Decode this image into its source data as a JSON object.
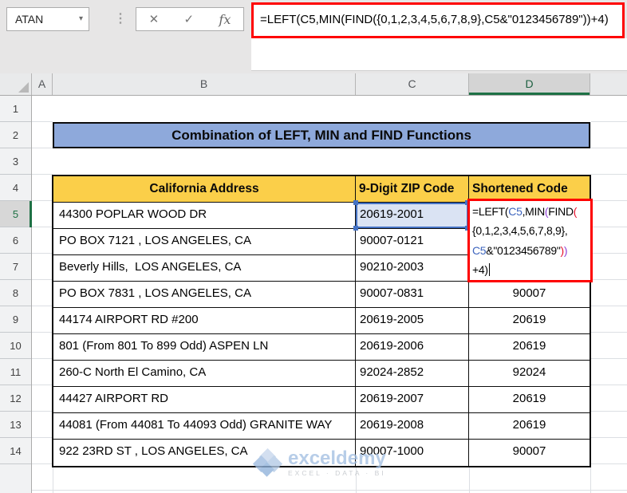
{
  "chrome": {
    "name_box": "ATAN",
    "formula": "=LEFT(C5,MIN(FIND({0,1,2,3,4,5,6,7,8,9},C5&\"0123456789\"))+4)",
    "cancel_icon": "✕",
    "enter_icon": "✓",
    "fx_icon": "fx",
    "dropdown_icon": "▼",
    "dots_icon": "⋮"
  },
  "grid": {
    "columns": [
      "A",
      "B",
      "C",
      "D"
    ],
    "selected_column": "D",
    "rows": [
      1,
      2,
      3,
      4,
      5,
      6,
      7,
      8,
      9,
      10,
      11,
      12,
      13,
      14
    ],
    "selected_row": 5
  },
  "sheet": {
    "title": "Combination of LEFT, MIN and FIND Functions",
    "table": {
      "headers": [
        "California Address",
        "9-Digit ZIP Code",
        "Shortened Code"
      ],
      "rows": [
        {
          "address": "44300 POPLAR WOOD DR",
          "zip": "20619-2001",
          "code": ""
        },
        {
          "address": "PO BOX 7121 , LOS ANGELES, CA",
          "zip": "90007-0121",
          "code": ""
        },
        {
          "address": "Beverly Hills,  LOS ANGELES, CA",
          "zip": "90210-2003",
          "code": ""
        },
        {
          "address": "PO BOX 7831 , LOS ANGELES, CA",
          "zip": "90007-0831",
          "code": "90007"
        },
        {
          "address": "44174 AIRPORT RD #200",
          "zip": "20619-2005",
          "code": "20619"
        },
        {
          "address": "801 (From 801 To 899 Odd) ASPEN LN",
          "zip": "20619-2006",
          "code": "20619"
        },
        {
          "address": "260-C North El Camino, CA",
          "zip": "92024-2852",
          "code": "92024"
        },
        {
          "address": "44427 AIRPORT RD",
          "zip": "20619-2007",
          "code": "20619"
        },
        {
          "address": "44081 (From 44081 To 44093 Odd) GRANITE WAY",
          "zip": "20619-2008",
          "code": "20619"
        },
        {
          "address": "922 23RD ST , LOS ANGELES, CA",
          "zip": "90007-1000",
          "code": "90007"
        }
      ]
    },
    "formula_cell": {
      "lines": [
        [
          {
            "t": "=LEFT(",
            "c": "k"
          },
          {
            "t": "C5",
            "c": "b"
          },
          {
            "t": ",MIN",
            "c": "k"
          },
          {
            "t": "(",
            "c": "p"
          },
          {
            "t": "FIND",
            "c": "k"
          },
          {
            "t": "(",
            "c": "r"
          }
        ],
        [
          {
            "t": "{0,1,2,3,4,5,6,7,8,9},",
            "c": "k"
          }
        ],
        [
          {
            "t": "C5",
            "c": "b"
          },
          {
            "t": "&\"0123456789\"",
            "c": "k"
          },
          {
            "t": ")",
            "c": "r"
          },
          {
            "t": ")",
            "c": "p"
          }
        ],
        [
          {
            "t": "+4)",
            "c": "k"
          }
        ]
      ]
    }
  },
  "watermark": {
    "brand": "exceldemy",
    "tagline": "EXCEL · DATA · BI"
  },
  "colors": {
    "annotation_red": "#FE0000",
    "title_fill": "#8EA9DB",
    "header_fill": "#FBCF49",
    "excel_green": "#1E7145",
    "ref_cell_fill": "#DAE3F3",
    "ref_border_blue": "#4472C4",
    "formula_black": "#000000",
    "formula_blue": "#3E65BE",
    "formula_red": "#E8112D",
    "formula_purple": "#9141D6"
  }
}
